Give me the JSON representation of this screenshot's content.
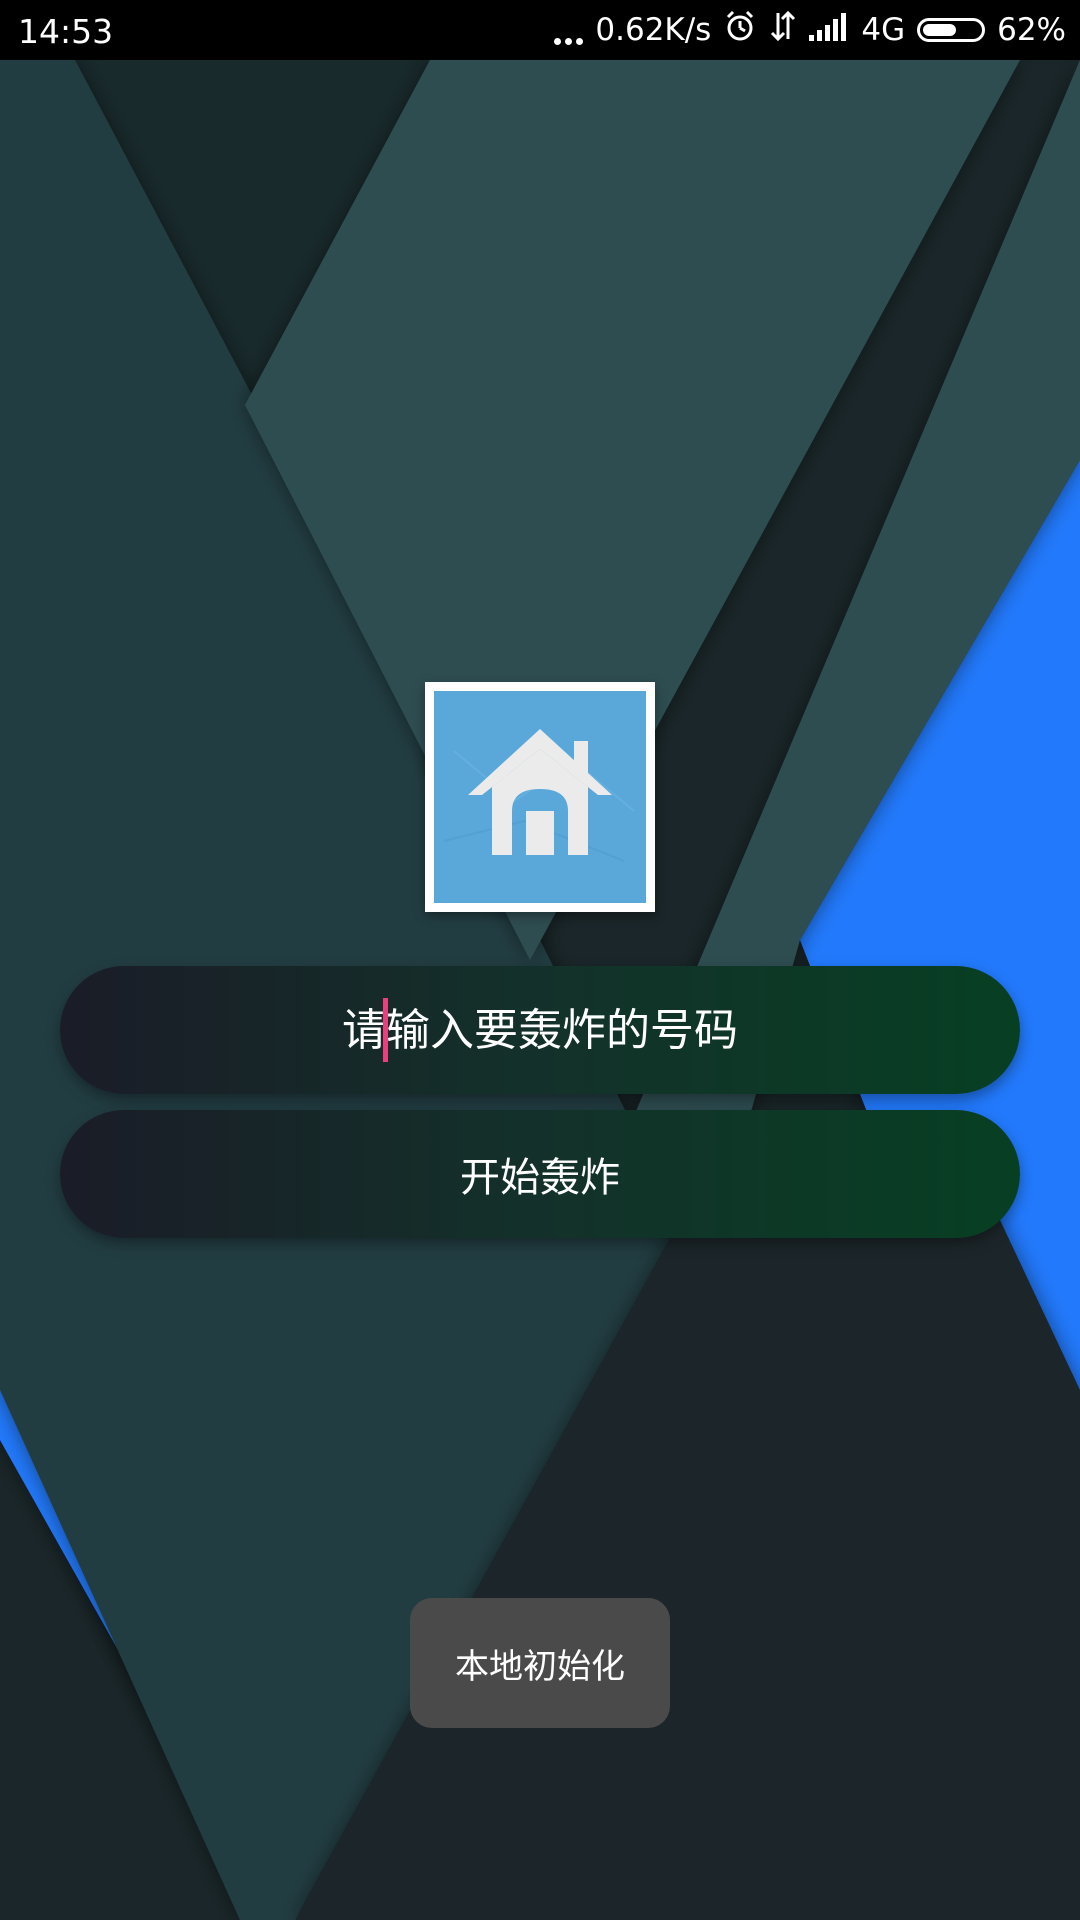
{
  "status_bar": {
    "time": "14:53",
    "network_speed": "0.62K/s",
    "network_type": "4G",
    "battery_percent": "62%",
    "battery_level": 0.62,
    "icons": [
      "more-dots-icon",
      "alarm-icon",
      "data-transfer-icon",
      "signal-icon",
      "battery-icon"
    ]
  },
  "logo": {
    "icon": "house-icon",
    "background_color": "#5aa8da"
  },
  "phone_input": {
    "placeholder": "请输入要轰炸的号码",
    "value": ""
  },
  "start_button": {
    "label": "开始轰炸"
  },
  "toast": {
    "message": "本地初始化"
  },
  "colors": {
    "accent_blue": "#2479fb",
    "caret": "#e8407f",
    "pill_gradient_start": "#1a1c27",
    "pill_gradient_end": "#073f23"
  }
}
